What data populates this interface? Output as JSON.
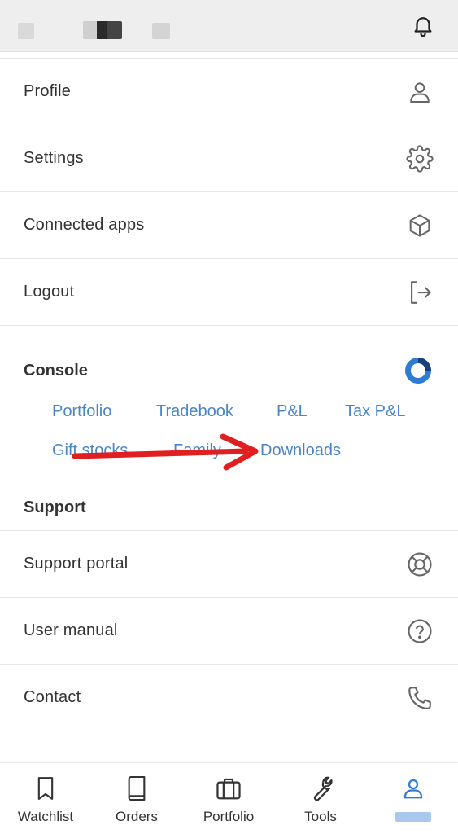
{
  "menu": {
    "items": [
      {
        "label": "Profile",
        "icon": "person-icon"
      },
      {
        "label": "Settings",
        "icon": "gear-icon"
      },
      {
        "label": "Connected apps",
        "icon": "cube-icon"
      },
      {
        "label": "Logout",
        "icon": "logout-icon"
      }
    ]
  },
  "console": {
    "title": "Console",
    "links": [
      "Portfolio",
      "Tradebook",
      "P&L",
      "Tax P&L",
      "Gift stocks",
      "Family",
      "Downloads"
    ]
  },
  "support": {
    "title": "Support",
    "items": [
      {
        "label": "Support portal",
        "icon": "lifebuoy-icon"
      },
      {
        "label": "User manual",
        "icon": "question-icon"
      },
      {
        "label": "Contact",
        "icon": "phone-icon"
      }
    ]
  },
  "bottom_nav": {
    "items": [
      {
        "label": "Watchlist",
        "icon": "bookmark-icon"
      },
      {
        "label": "Orders",
        "icon": "book-icon"
      },
      {
        "label": "Portfolio",
        "icon": "briefcase-icon"
      },
      {
        "label": "Tools",
        "icon": "wrench-icon"
      }
    ],
    "active_icon": "person-icon"
  },
  "colors": {
    "link": "#4a86c5",
    "text": "#333333",
    "icon": "#666666",
    "accent": "#2e7bd6",
    "annotation_arrow": "#e02020"
  }
}
